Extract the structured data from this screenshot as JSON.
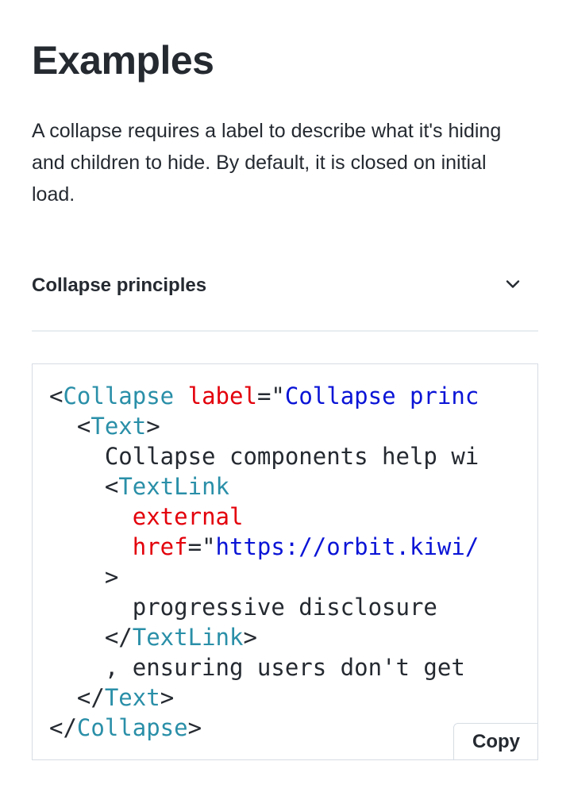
{
  "section": {
    "title": "Examples",
    "intro": "A collapse requires a label to describe what it's hiding and children to hide. By default, it is closed on initial load."
  },
  "collapse": {
    "label": "Collapse principles",
    "toggle_icon": "chevron-down-icon",
    "expanded": false
  },
  "code_example": {
    "language": "jsx",
    "line1": {
      "open": "<",
      "tag": "Collapse",
      "space": " ",
      "attr": "label",
      "eq": "=",
      "quote": "\"",
      "value": "Collapse princ"
    },
    "line2": {
      "indent": "  ",
      "open": "<",
      "tag": "Text",
      "close": ">"
    },
    "line3": {
      "indent": "    ",
      "text": "Collapse components help wi"
    },
    "line4": {
      "indent": "    ",
      "open": "<",
      "tag": "TextLink"
    },
    "line5": {
      "indent": "      ",
      "attr": "external"
    },
    "line6": {
      "indent": "      ",
      "attr": "href",
      "eq": "=",
      "quote": "\"",
      "value": "https://orbit.kiwi/"
    },
    "line7": {
      "indent": "    ",
      "text": ">"
    },
    "line8": {
      "indent": "      ",
      "text": "progressive disclosure"
    },
    "line9": {
      "indent": "    ",
      "open": "</",
      "tag": "TextLink",
      "close": ">"
    },
    "line10": {
      "indent": "    ",
      "text": ", ensuring users don't get"
    },
    "line11": {
      "indent": "  ",
      "open": "</",
      "tag": "Text",
      "close": ">"
    },
    "line12": {
      "open": "</",
      "tag": "Collapse",
      "close": ">"
    },
    "copy_label": "Copy"
  },
  "colors": {
    "text": "#252a31",
    "tag": "#2a8fa8",
    "attribute": "#e3000b",
    "string": "#0a14d6",
    "divider": "#e8edf1",
    "border": "#d6dde4"
  }
}
